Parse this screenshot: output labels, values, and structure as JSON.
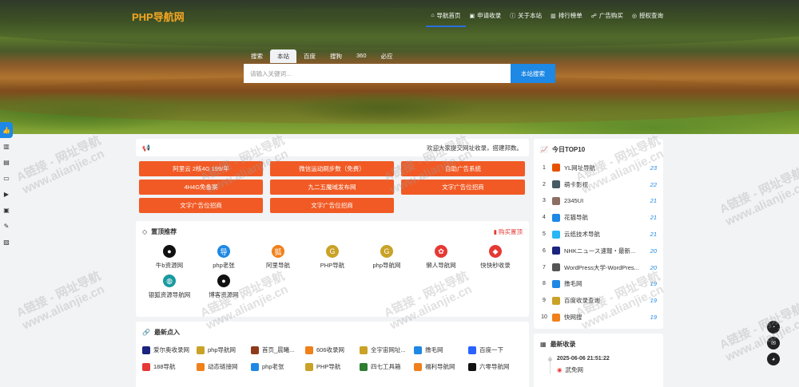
{
  "header": {
    "logo": "PHP导航网",
    "nav": [
      {
        "label": "导航首页",
        "icon": "home-icon",
        "glyph": "⌂",
        "active": true
      },
      {
        "label": "申请收录",
        "icon": "apply-icon",
        "glyph": "▣",
        "active": false
      },
      {
        "label": "关于本站",
        "icon": "info-icon",
        "glyph": "ⓘ",
        "active": false
      },
      {
        "label": "排行榜单",
        "icon": "rank-icon",
        "glyph": "▥",
        "active": false
      },
      {
        "label": "广告购买",
        "icon": "ad-icon",
        "glyph": "☍",
        "active": false
      },
      {
        "label": "授权查询",
        "icon": "auth-icon",
        "glyph": "◎",
        "active": false
      }
    ]
  },
  "search": {
    "tabs": [
      "搜索",
      "本站",
      "百度",
      "搜狗",
      "360",
      "必应"
    ],
    "active_tab": 1,
    "placeholder": "请输入关键词...",
    "button": "本站搜索"
  },
  "notice": {
    "icon": "megaphone-icon",
    "text": "欢迎大家提交网址收录，搭建邦数。"
  },
  "ads": [
    "阿里云 2核4G 199/年",
    "微信运动刷步数（免费）",
    "自助广告系统",
    "4H4G免备案",
    "九二五魔域发布网",
    "文字广告位招商",
    "文字广告位招商",
    "文字广告位招商"
  ],
  "top_recommend": {
    "title": "置顶推荐",
    "buy_label": "购买置顶",
    "items": [
      {
        "label": "牛b资源网",
        "color": "#111111",
        "glyph": "●"
      },
      {
        "label": "php老张",
        "color": "#1e88e5",
        "glyph": "导"
      },
      {
        "label": "阿里导航",
        "color": "#f0801a",
        "glyph": "狐"
      },
      {
        "label": "PHP导航",
        "color": "#c9a227",
        "glyph": "G"
      },
      {
        "label": "php导航网",
        "color": "#c9a227",
        "glyph": "G"
      },
      {
        "label": "懒人导航网",
        "color": "#e53935",
        "glyph": "✿"
      },
      {
        "label": "快快秒收录",
        "color": "#e53935",
        "glyph": "◆"
      },
      {
        "label": "银狐资源导航网",
        "color": "#1a9aa0",
        "glyph": "◍"
      },
      {
        "label": "博客资源网",
        "color": "#111111",
        "glyph": "●"
      }
    ]
  },
  "latest": {
    "title": "最新点入",
    "items": [
      {
        "label": "爱尔奥收录网",
        "color": "#1a237e"
      },
      {
        "label": "php导航网",
        "color": "#c9a227"
      },
      {
        "label": "首页_晨曦...",
        "color": "#8d3b1c"
      },
      {
        "label": "606收录网",
        "color": "#f0801a"
      },
      {
        "label": "全宇宙网址...",
        "color": "#c9a227"
      },
      {
        "label": "撸毛网",
        "color": "#1e88e5"
      },
      {
        "label": "百度一下",
        "color": "#2962ff"
      },
      {
        "label": "188导航",
        "color": "#e53935"
      },
      {
        "label": "动态链接网",
        "color": "#f0801a"
      },
      {
        "label": "php老张",
        "color": "#1e88e5"
      },
      {
        "label": "PHP导航",
        "color": "#c9a227"
      },
      {
        "label": "四七工具箱",
        "color": "#2e7d32"
      },
      {
        "label": "福利导航网",
        "color": "#f0801a"
      },
      {
        "label": "六零导航网",
        "color": "#111111"
      }
    ]
  },
  "top10": {
    "title": "今日TOP10",
    "items": [
      {
        "rank": "1",
        "name": "YL网址导航",
        "count": "23",
        "color": "#e65100"
      },
      {
        "rank": "2",
        "name": "萌卡影视",
        "count": "22",
        "color": "#455a64"
      },
      {
        "rank": "3",
        "name": "2345UI",
        "count": "21",
        "color": "#8d6e63"
      },
      {
        "rank": "4",
        "name": "花猫导航",
        "count": "21",
        "color": "#1e88e5"
      },
      {
        "rank": "5",
        "name": "云纸技术导航",
        "count": "21",
        "color": "#29b6f6"
      },
      {
        "rank": "6",
        "name": "NHKニュース速報・最新...",
        "count": "20",
        "color": "#1a237e"
      },
      {
        "rank": "7",
        "name": "WordPress大学-WordPres...",
        "count": "20",
        "color": "#555555"
      },
      {
        "rank": "8",
        "name": "撸毛网",
        "count": "19",
        "color": "#1e88e5"
      },
      {
        "rank": "9",
        "name": "百度收录查询",
        "count": "19",
        "color": "#c9a227"
      },
      {
        "rank": "10",
        "name": "快网搜",
        "count": "19",
        "color": "#f0801a"
      }
    ]
  },
  "newin": {
    "title": "最新收录",
    "entries": [
      {
        "time": "2025-06-06 21:51:22",
        "name": "武免网"
      }
    ]
  },
  "left_sidebar": [
    {
      "icon": "thumb-icon",
      "glyph": "👍"
    },
    {
      "icon": "bank-icon",
      "glyph": "▥"
    },
    {
      "icon": "server-icon",
      "glyph": "▤"
    },
    {
      "icon": "laptop-icon",
      "glyph": "▭"
    },
    {
      "icon": "video-icon",
      "glyph": "▶"
    },
    {
      "icon": "monitor-icon",
      "glyph": "▣"
    },
    {
      "icon": "wrench-icon",
      "glyph": "✎"
    },
    {
      "icon": "image-icon",
      "glyph": "▨"
    }
  ],
  "right_float": [
    {
      "icon": "qq-icon",
      "glyph": "◔"
    },
    {
      "icon": "mail-icon",
      "glyph": "✉"
    },
    {
      "icon": "wechat-icon",
      "glyph": "◕"
    }
  ],
  "watermark": {
    "line1": "A链接 - 网址导航",
    "line2": "www.alianjie.cn"
  }
}
